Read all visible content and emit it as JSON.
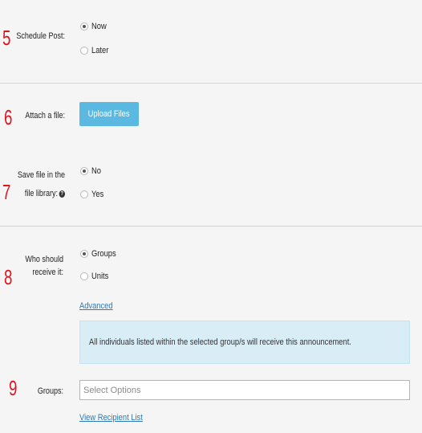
{
  "schedule": {
    "step": "5",
    "label": "Schedule Post:",
    "options": [
      {
        "label": "Now",
        "checked": true
      },
      {
        "label": "Later",
        "checked": false
      }
    ]
  },
  "attach": {
    "step": "6",
    "label": "Attach a file:",
    "button_label": "Upload Files"
  },
  "save_library": {
    "step": "7",
    "label_line1": "Save file in the",
    "label_line2": "file library:",
    "help_icon": "question-icon",
    "options": [
      {
        "label": "No",
        "checked": true
      },
      {
        "label": "Yes",
        "checked": false
      }
    ]
  },
  "recipients": {
    "step": "8",
    "label_line1": "Who should",
    "label_line2": "receive it:",
    "options": [
      {
        "label": "Groups",
        "checked": true
      },
      {
        "label": "Units",
        "checked": false
      }
    ],
    "advanced_link": "Advanced",
    "info_text": "All individuals listed within the selected group/s will receive this announcement."
  },
  "groups": {
    "step": "9",
    "label": "Groups:",
    "placeholder": "Select Options",
    "view_link": "View Recipient List"
  },
  "colors": {
    "step_red": "#e0141e",
    "button_blue": "#5bb9e1",
    "info_bg": "#d9edf7",
    "link_blue": "#2a7ab8"
  }
}
